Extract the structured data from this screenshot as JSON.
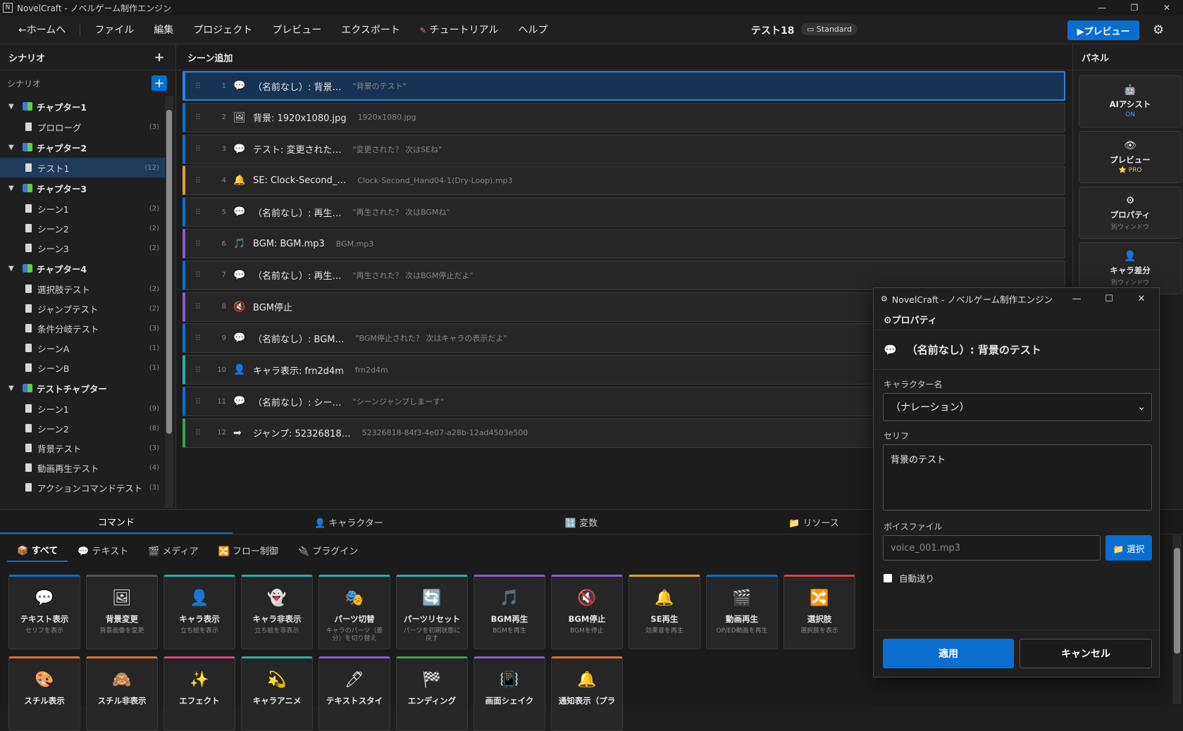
{
  "window": {
    "title": "NovelCraft - ノベルゲーム制作エンジン",
    "min": "—",
    "max": "❐",
    "close": "✕"
  },
  "menu": {
    "home": "←ホームへ",
    "items": [
      "ファイル",
      "編集",
      "プロジェクト",
      "プレビュー",
      "エクスポート",
      "チュートリアル",
      "ヘルプ"
    ],
    "project_name": "テスト18",
    "edition": "Standard",
    "preview_button": "▶プレビュー"
  },
  "scenario_panel": {
    "title": "シナリオ",
    "subtitle": "シナリオ",
    "tree": [
      {
        "type": "chapter",
        "label": "チャプター1"
      },
      {
        "type": "scene",
        "label": "プロローグ",
        "count": "(3)"
      },
      {
        "type": "chapter",
        "label": "チャプター2"
      },
      {
        "type": "scene",
        "label": "テスト1",
        "count": "(12)",
        "selected": true
      },
      {
        "type": "chapter",
        "label": "チャプター3"
      },
      {
        "type": "scene",
        "label": "シーン1",
        "count": "(2)"
      },
      {
        "type": "scene",
        "label": "シーン2",
        "count": "(2)"
      },
      {
        "type": "scene",
        "label": "シーン3",
        "count": "(2)"
      },
      {
        "type": "chapter",
        "label": "チャプター4"
      },
      {
        "type": "scene",
        "label": "選択肢テスト",
        "count": "(2)"
      },
      {
        "type": "scene",
        "label": "ジャンプテスト",
        "count": "(2)"
      },
      {
        "type": "scene",
        "label": "条件分岐テスト",
        "count": "(3)"
      },
      {
        "type": "scene",
        "label": "シーンA",
        "count": "(1)"
      },
      {
        "type": "scene",
        "label": "シーンB",
        "count": "(1)"
      },
      {
        "type": "chapter",
        "label": "テストチャプター"
      },
      {
        "type": "scene",
        "label": "シーン1",
        "count": "(9)"
      },
      {
        "type": "scene",
        "label": "シーン2",
        "count": "(8)"
      },
      {
        "type": "scene",
        "label": "背景テスト",
        "count": "(3)"
      },
      {
        "type": "scene",
        "label": "動画再生テスト",
        "count": "(4)"
      },
      {
        "type": "scene",
        "label": "アクションコマンドテスト",
        "count": "(3)"
      }
    ]
  },
  "scene_panel": {
    "title": "シーン追加",
    "commands": [
      {
        "num": "1",
        "icon": "💬",
        "title": "（名前なし）: 背景…",
        "detail": "\"背景のテスト\"",
        "color": "#2a84e0",
        "active": true
      },
      {
        "num": "2",
        "icon": "🖼",
        "title": "背景: 1920x1080.jpg",
        "detail": "1920x1080.jpg",
        "color": "#0a6ed1"
      },
      {
        "num": "3",
        "icon": "💬",
        "title": "テスト: 変更された…",
        "detail": "\"変更された？ 次はSEね\"",
        "color": "#0a6ed1"
      },
      {
        "num": "4",
        "icon": "🔔",
        "title": "SE: Clock-Second_…",
        "detail": "Clock-Second_Hand04-1(Dry-Loop).mp3",
        "color": "#e0a030"
      },
      {
        "num": "5",
        "icon": "💬",
        "title": "（名前なし）: 再生…",
        "detail": "\"再生された？ 次はBGMね\"",
        "color": "#0a6ed1"
      },
      {
        "num": "6",
        "icon": "🎵",
        "title": "BGM: BGM.mp3",
        "detail": "BGM.mp3",
        "color": "#8a5cd0"
      },
      {
        "num": "7",
        "icon": "💬",
        "title": "（名前なし）: 再生…",
        "detail": "\"再生された？ 次はBGM停止だよ\"",
        "color": "#0a6ed1"
      },
      {
        "num": "8",
        "icon": "🔇",
        "title": "BGM停止",
        "detail": "",
        "color": "#8a5cd0"
      },
      {
        "num": "9",
        "icon": "💬",
        "title": "（名前なし）: BGM…",
        "detail": "\"BGM停止された？ 次はキャラの表示だよ\"",
        "color": "#0a6ed1"
      },
      {
        "num": "10",
        "icon": "👤",
        "title": "キャラ表示: frn2d4m",
        "detail": "frn2d4m",
        "color": "#2ab0a0"
      },
      {
        "num": "11",
        "icon": "💬",
        "title": "（名前なし）: シー…",
        "detail": "\"シーンジャンプしまーす\"",
        "color": "#0a6ed1"
      },
      {
        "num": "12",
        "icon": "➡",
        "title": "ジャンプ: 52326818…",
        "detail": "52326818-84f3-4e07-a28b-12ad4503e500",
        "color": "#3aa05a"
      }
    ]
  },
  "right_panel": {
    "title": "パネル",
    "cards": [
      {
        "icon": "🤖",
        "label": "AIアシスト",
        "sub": "ON",
        "sub_color": "#3aa0ff"
      },
      {
        "icon": "👁",
        "label": "プレビュー",
        "sub": "⭐ PRO",
        "sub_color": "#f0c040"
      },
      {
        "icon": "⚙",
        "label": "プロパティ",
        "sub": "別ウィンドウ",
        "sub_color": "#888"
      },
      {
        "icon": "👤",
        "label": "キャラ差分",
        "sub": "別ウィンドウ",
        "sub_color": "#888"
      }
    ]
  },
  "bottom_tabs": [
    "コマンド",
    "👤 キャラクター",
    "🔢 変数",
    "📁 リソース"
  ],
  "filter_tabs": [
    "📦 すべて",
    "💬 テキスト",
    "🎬 メディア",
    "🔀 フロー制御",
    "🔌 プラグイン"
  ],
  "command_cards": [
    {
      "icon": "💬",
      "label": "テキスト表示",
      "desc": "セリフを表示",
      "color": "#0a6ed1"
    },
    {
      "icon": "🖼",
      "label": "背景変更",
      "desc": "背景画像を変更",
      "color": "#555"
    },
    {
      "icon": "👤",
      "label": "キャラ表示",
      "desc": "立ち絵を表示",
      "color": "#2ab0a0"
    },
    {
      "icon": "👻",
      "label": "キャラ非表示",
      "desc": "立ち絵を非表示",
      "color": "#2ab0a0"
    },
    {
      "icon": "🎭",
      "label": "パーツ切替",
      "desc": "キャラのパーツ（差分）を切り替え",
      "color": "#2ab0a0"
    },
    {
      "icon": "🔄",
      "label": "パーツリセット",
      "desc": "パーツを初期状態に戻す",
      "color": "#2ab0a0"
    },
    {
      "icon": "🎵",
      "label": "BGM再生",
      "desc": "BGMを再生",
      "color": "#8a5cd0"
    },
    {
      "icon": "🔇",
      "label": "BGM停止",
      "desc": "BGMを停止",
      "color": "#8a5cd0"
    },
    {
      "icon": "🔔",
      "label": "SE再生",
      "desc": "効果音を再生",
      "color": "#e0a030"
    },
    {
      "icon": "🎬",
      "label": "動画再生",
      "desc": "OP/ED動画を再生",
      "color": "#0a6ed1"
    },
    {
      "icon": "🔀",
      "label": "選択肢",
      "desc": "選択肢を表示",
      "color": "#e04040"
    },
    {
      "icon": "🎨",
      "label": "スチル表示",
      "desc": "",
      "color": "#e07030"
    },
    {
      "icon": "🙈",
      "label": "スチル非表示",
      "desc": "",
      "color": "#e07030"
    },
    {
      "icon": "✨",
      "label": "エフェクト",
      "desc": "",
      "color": "#e04080"
    },
    {
      "icon": "💫",
      "label": "キャラアニメ",
      "desc": "",
      "color": "#2ab0a0"
    },
    {
      "icon": "🖊",
      "label": "テキストスタイ",
      "desc": "",
      "color": "#8a5cd0"
    },
    {
      "icon": "🏁",
      "label": "エンディング",
      "desc": "",
      "color": "#3aa05a"
    },
    {
      "icon": "📳",
      "label": "画面シェイク",
      "desc": "",
      "color": "#8a5cd0"
    },
    {
      "icon": "🔔",
      "label": "通知表示（プラ",
      "desc": "",
      "color": "#e07030"
    }
  ],
  "modal": {
    "title": "NovelCraft - ノベルゲーム制作エンジン",
    "header": "⚙プロパティ",
    "command_title": "（名前なし）: 背景のテスト",
    "character_label": "キャラクター名",
    "character_value": "（ナレーション）",
    "line_label": "セリフ",
    "line_value": "背景のテスト",
    "voice_label": "ボイスファイル",
    "voice_placeholder": "voice_001.mp3",
    "select_button": "📁 選択",
    "auto_label": "自動送り",
    "apply": "適用",
    "cancel": "キャンセル"
  }
}
